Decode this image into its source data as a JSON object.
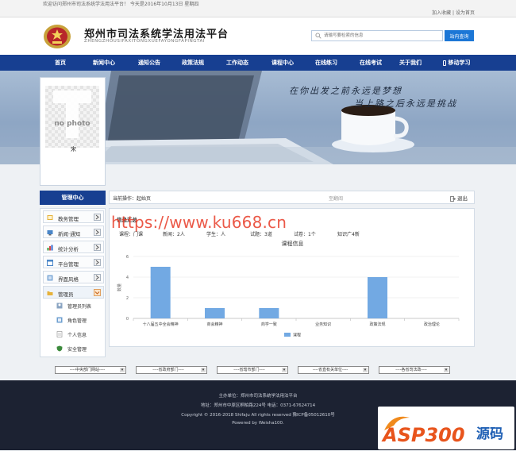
{
  "topbar": {
    "welcome": "欢迎访问郑州市司法系统学法用法平台！  今天是2016年10月13日 星期四",
    "add_favorite": "加入收藏",
    "separator": " | ",
    "set_home": "设为首页"
  },
  "header": {
    "title": "郑州市司法系统学法用法平台",
    "subtitle": "ZHENGZHOUSIFAXITONGXUEFAYONGFAPINGTAI",
    "search_placeholder": "请输写要检索的信息",
    "search_button": "站内查询"
  },
  "nav": [
    "首页",
    "新闻中心",
    "通知公告",
    "政策法规",
    "工作动态",
    "课程中心",
    "在线练习",
    "在线考试",
    "关于我们",
    "移动学习"
  ],
  "banner": {
    "slogan_line1": "在你出发之前永远是梦想",
    "slogan_line2": "当上路之后永远是挑战"
  },
  "profile": {
    "avatar_text": "no photo",
    "name": "宋"
  },
  "sidebar": {
    "header": "管理中心",
    "items": [
      {
        "label": "教务管理"
      },
      {
        "label": "新闻·通知"
      },
      {
        "label": "统计分析"
      },
      {
        "label": "平台管理"
      },
      {
        "label": "界面风格"
      },
      {
        "label": "管理员"
      }
    ],
    "sub_items": [
      {
        "label": "管理员列表"
      },
      {
        "label": "角色管理"
      },
      {
        "label": "个人信息"
      },
      {
        "label": "安全管理"
      }
    ]
  },
  "breadcrumb": {
    "label": "当前操作：",
    "current": "起始页",
    "center": "至翻阅",
    "exit": "退出"
  },
  "content": {
    "heading": "信息汇总",
    "stats": [
      "课程：门课",
      "新闻：2人",
      "学生：人",
      "试题：3道",
      "试卷：1个",
      "知识广4新"
    ]
  },
  "chart_data": {
    "type": "bar",
    "title": "课程信息",
    "categories": [
      "十八届五中全会精神",
      "商会精神",
      "商学一致",
      "业务知识",
      "政策法规",
      "政治理论"
    ],
    "series": [
      {
        "name": "课程",
        "values": [
          5,
          1,
          1,
          0,
          4,
          0
        ]
      }
    ],
    "ylabel": "数量",
    "ylim": [
      0,
      6
    ],
    "yticks": [
      0,
      2,
      4,
      6
    ],
    "grid": true,
    "legend": "bottom",
    "color": "#72a9e3"
  },
  "watermark": "https://www.ku668.cn",
  "selects": [
    "----中央部门网站----",
    "----省政府部门----",
    "----省辖市部门----",
    "----省直有关单位----",
    "----各省司法政----"
  ],
  "footer": {
    "line1": "主办单位：郑州市司法系统学法用法平台",
    "line2": "地址：郑州市中原区桐柏路224号    电话：0371-67624714",
    "line3": "Copyright © 2016-2018 Shifaju All rights reserved   豫ICP备05012610号",
    "line4": "Powered by Weisha100.",
    "asp_logo": "ASP300",
    "asp_sub": "源码"
  },
  "colors": {
    "nav": "#173f91",
    "accent": "#1c77d6",
    "bar": "#72a9e3",
    "footer": "#1c2232"
  }
}
